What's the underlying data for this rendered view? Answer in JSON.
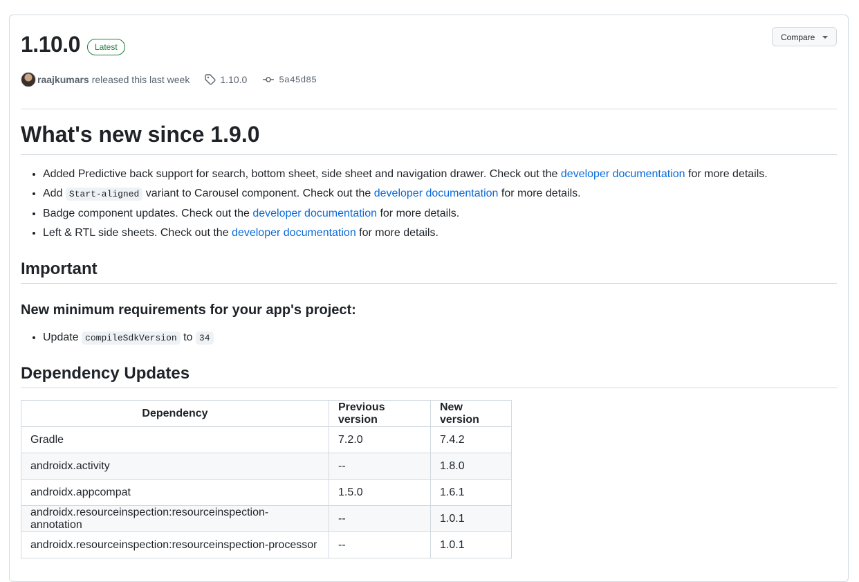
{
  "release": {
    "version": "1.10.0",
    "badge": "Latest",
    "compare_label": "Compare",
    "author": "raajkumars",
    "released_text": "released this last week",
    "tag": "1.10.0",
    "commit": "5a45d85"
  },
  "whats_new": {
    "heading": "What's new since 1.9.0",
    "items": [
      {
        "pre": "Added Predictive back support for search, bottom sheet, side sheet and navigation drawer. Check out the ",
        "link": "developer documentation",
        "post": " for more details."
      },
      {
        "pre": "Add ",
        "code": "Start-aligned",
        "mid": " variant to Carousel component. Check out the ",
        "link": "developer documentation",
        "post": " for more details."
      },
      {
        "pre": "Badge component updates. Check out the ",
        "link": "developer documentation",
        "post": " for more details."
      },
      {
        "pre": "Left & RTL side sheets. Check out the ",
        "link": "developer documentation",
        "post": " for more details."
      }
    ]
  },
  "important": {
    "heading": "Important",
    "subheading": "New minimum requirements for your app's project:",
    "item_pre": "Update ",
    "item_code1": "compileSdkVersion",
    "item_mid": " to ",
    "item_code2": "34"
  },
  "dependency_updates": {
    "heading": "Dependency Updates",
    "columns": [
      "Dependency",
      "Previous version",
      "New version"
    ],
    "rows": [
      [
        "Gradle",
        "7.2.0",
        "7.4.2"
      ],
      [
        "androidx.activity",
        "--",
        "1.8.0"
      ],
      [
        "androidx.appcompat",
        "1.5.0",
        "1.6.1"
      ],
      [
        "androidx.resourceinspection:resourceinspection-annotation",
        "--",
        "1.0.1"
      ],
      [
        "androidx.resourceinspection:resourceinspection-processor",
        "--",
        "1.0.1"
      ]
    ]
  }
}
